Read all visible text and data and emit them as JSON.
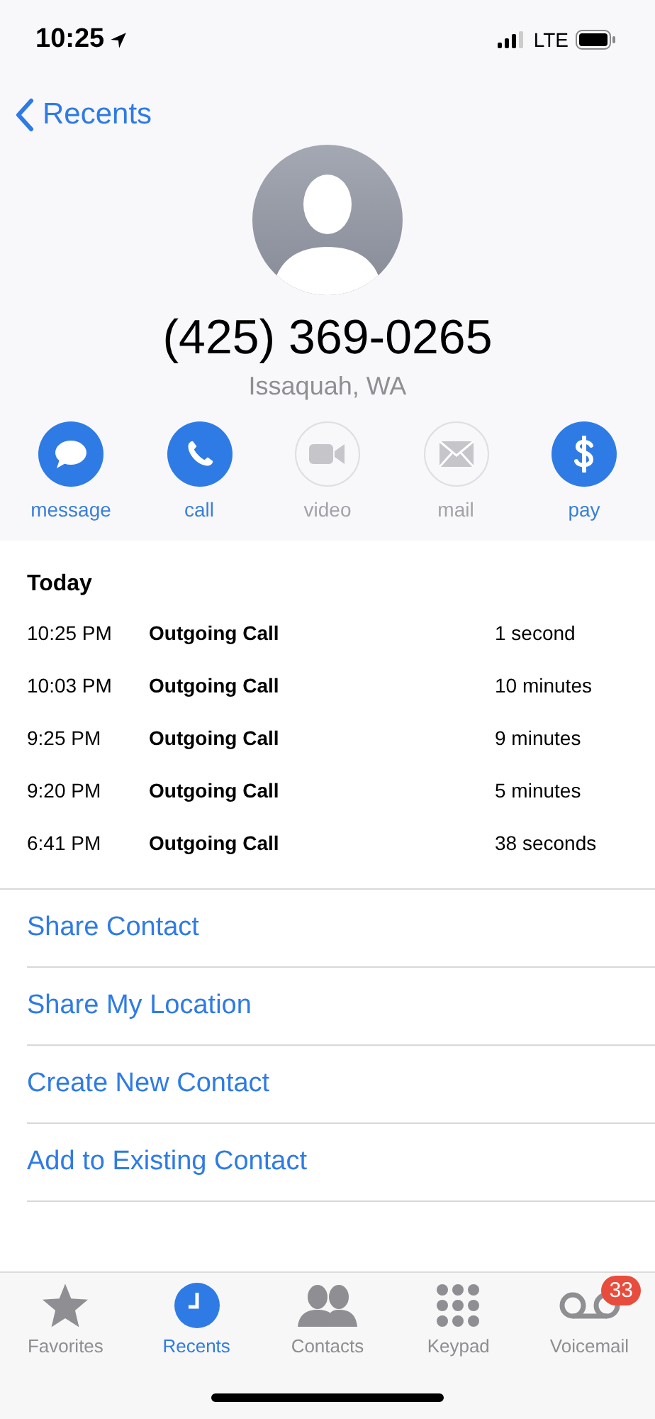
{
  "status_bar": {
    "time": "10:25",
    "network": "LTE"
  },
  "nav": {
    "back": "Recents"
  },
  "contact": {
    "number": "(425) 369-0265",
    "location": "Issaquah, WA"
  },
  "actions": [
    {
      "kind": "message",
      "label": "message",
      "disabled": false
    },
    {
      "kind": "call",
      "label": "call",
      "disabled": false
    },
    {
      "kind": "video",
      "label": "video",
      "disabled": true
    },
    {
      "kind": "mail",
      "label": "mail",
      "disabled": true
    },
    {
      "kind": "pay",
      "label": "pay",
      "disabled": false
    }
  ],
  "history": {
    "heading": "Today",
    "calls": [
      {
        "time": "10:25 PM",
        "type": "Outgoing Call",
        "duration": "1 second"
      },
      {
        "time": "10:03 PM",
        "type": "Outgoing Call",
        "duration": "10 minutes"
      },
      {
        "time": "9:25 PM",
        "type": "Outgoing Call",
        "duration": "9 minutes"
      },
      {
        "time": "9:20 PM",
        "type": "Outgoing Call",
        "duration": "5 minutes"
      },
      {
        "time": "6:41 PM",
        "type": "Outgoing Call",
        "duration": "38 seconds"
      }
    ]
  },
  "links": [
    "Share Contact",
    "Share My Location",
    "Create New Contact",
    "Add to Existing Contact"
  ],
  "tabs": [
    {
      "kind": "favorites",
      "label": "Favorites",
      "selected": false
    },
    {
      "kind": "recents",
      "label": "Recents",
      "selected": true
    },
    {
      "kind": "contacts",
      "label": "Contacts",
      "selected": false
    },
    {
      "kind": "keypad",
      "label": "Keypad",
      "selected": false
    },
    {
      "kind": "voicemail",
      "label": "Voicemail",
      "selected": false,
      "badge": "33"
    }
  ]
}
